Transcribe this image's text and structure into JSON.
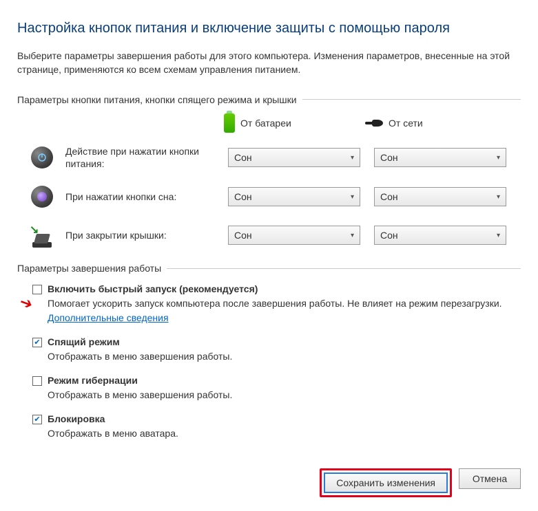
{
  "title": "Настройка кнопок питания и включение защиты с помощью пароля",
  "description": "Выберите параметры завершения работы для этого компьютера. Изменения параметров, внесенные на этой странице, применяются ко всем схемам управления питанием.",
  "group1": {
    "header": "Параметры кнопки питания, кнопки спящего режима и крышки",
    "col_battery": "От батареи",
    "col_ac": "От сети",
    "rows": [
      {
        "label": "Действие при нажатии кнопки питания:",
        "battery": "Сон",
        "ac": "Сон"
      },
      {
        "label": "При нажатии кнопки сна:",
        "battery": "Сон",
        "ac": "Сон"
      },
      {
        "label": "При закрытии крышки:",
        "battery": "Сон",
        "ac": "Сон"
      }
    ]
  },
  "group2": {
    "header": "Параметры завершения работы",
    "options": [
      {
        "checked": false,
        "title": "Включить быстрый запуск (рекомендуется)",
        "sub": "Помогает ускорить запуск компьютера после завершения работы. Не влияет на режим перезагрузки.",
        "link": "Дополнительные сведения"
      },
      {
        "checked": true,
        "title": "Спящий режим",
        "sub": "Отображать в меню завершения работы."
      },
      {
        "checked": false,
        "title": "Режим гибернации",
        "sub": "Отображать в меню завершения работы."
      },
      {
        "checked": true,
        "title": "Блокировка",
        "sub": "Отображать в меню аватара."
      }
    ]
  },
  "buttons": {
    "save": "Сохранить изменения",
    "cancel": "Отмена"
  }
}
